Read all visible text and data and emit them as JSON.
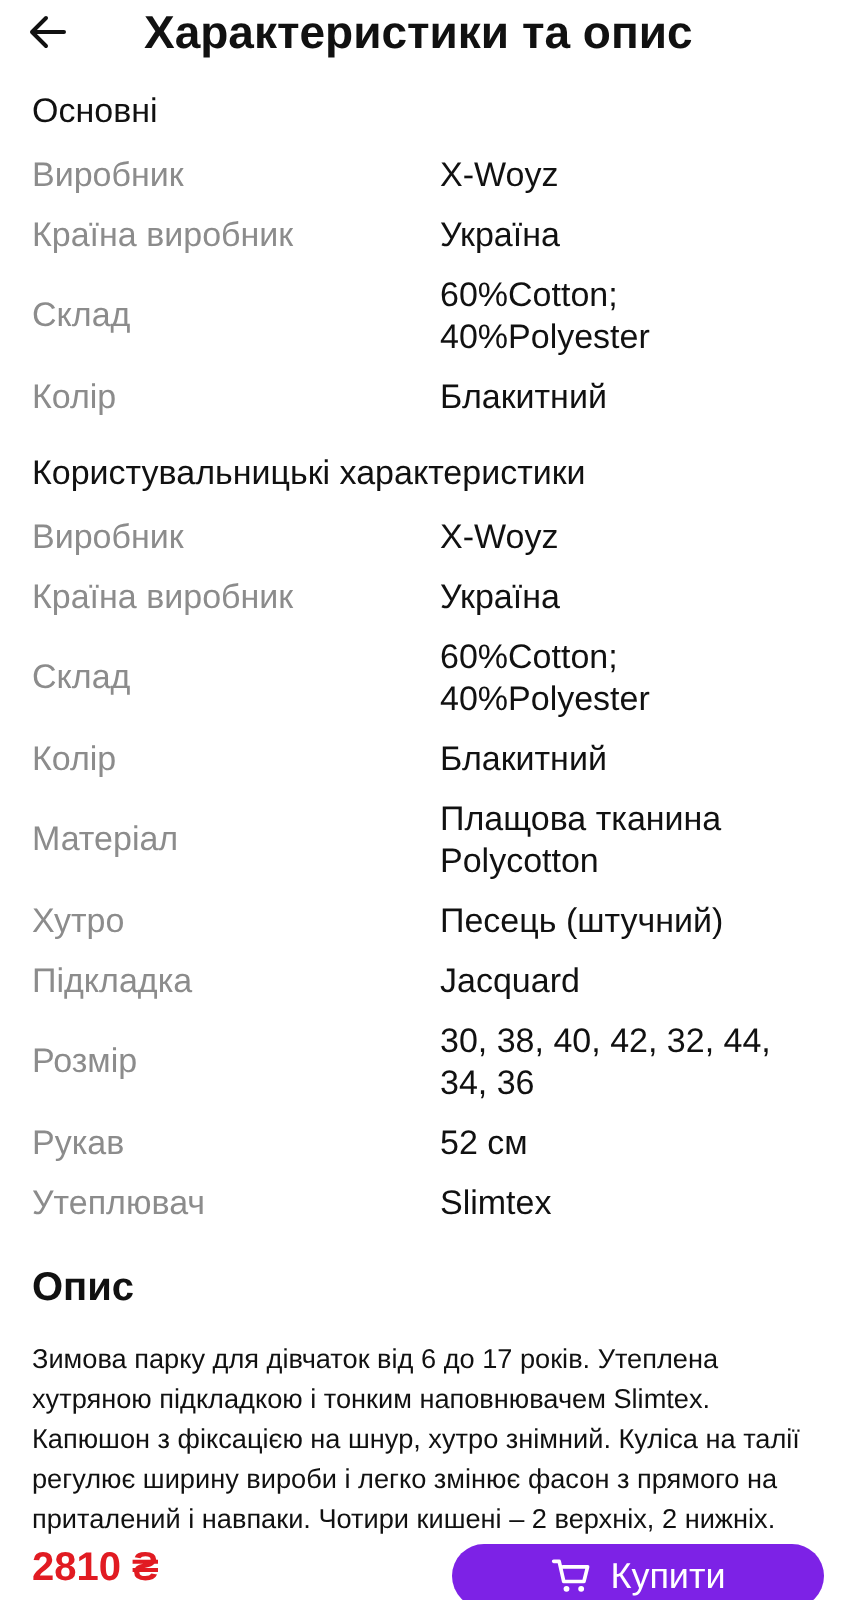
{
  "header": {
    "title": "Характеристики та опис"
  },
  "sections": [
    {
      "title": "Основні",
      "rows": [
        {
          "label": "Виробник",
          "value": "X-Woyz"
        },
        {
          "label": "Країна виробник",
          "value": "Україна"
        },
        {
          "label": "Склад",
          "value": "60%Cotton; 40%Polyester"
        },
        {
          "label": "Колір",
          "value": "Блакитний"
        }
      ]
    },
    {
      "title": "Користувальницькі характеристики",
      "rows": [
        {
          "label": "Виробник",
          "value": "X-Woyz"
        },
        {
          "label": "Країна виробник",
          "value": "Україна"
        },
        {
          "label": "Склад",
          "value": "60%Cotton; 40%Polyester"
        },
        {
          "label": "Колір",
          "value": "Блакитний"
        },
        {
          "label": "Матеріал",
          "value": "Плащова тканина Polycotton"
        },
        {
          "label": "Хутро",
          "value": "Песець (штучний)"
        },
        {
          "label": "Підкладка",
          "value": "Jacquard"
        },
        {
          "label": "Розмір",
          "value": "30, 38, 40, 42, 32, 44, 34, 36"
        },
        {
          "label": "Рукав",
          "value": "52 см"
        },
        {
          "label": "Утеплювач",
          "value": "Slimtex"
        }
      ]
    }
  ],
  "description": {
    "title": "Опис",
    "text": "Зимова парку для дівчаток від 6 до 17 років. Утеплена хутряною підкладкою і тонким наповнювачем Slimtex. Капюшон з фіксацією на шнур, хутро знімний. Куліса на талії регулює ширину вироби і легко змінює фасон з прямого на приталений і навпаки. Чотири кишені – 2 верхніх, 2 нижніх."
  },
  "bottom_bar": {
    "price": "2810 ₴",
    "buy_button": "Купити"
  }
}
